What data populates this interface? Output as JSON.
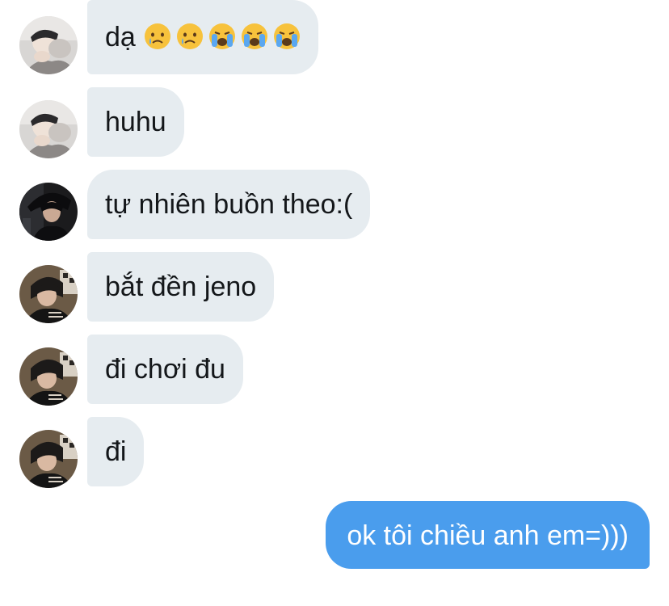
{
  "conversation": {
    "messages": [
      {
        "sender": "user-a",
        "text": "dạ",
        "emojis": [
          "crying-face-icon",
          "crying-face-icon",
          "loudly-crying-face-icon",
          "loudly-crying-face-icon",
          "loudly-crying-face-icon"
        ]
      },
      {
        "sender": "user-a",
        "text": "huhu"
      },
      {
        "sender": "user-b",
        "text": "tự nhiên buồn theo:("
      },
      {
        "sender": "user-c",
        "text": "bắt đền jeno"
      },
      {
        "sender": "user-c",
        "text": "đi chơi đu"
      },
      {
        "sender": "user-c",
        "text": "đi"
      },
      {
        "sender": "me",
        "text": "ok tôi chiều anh em=)))"
      }
    ]
  },
  "colors": {
    "incoming_bubble": "#e6ecf0",
    "outgoing_bubble": "#4a9ded",
    "text_dark": "#14171a",
    "text_light": "#ffffff"
  }
}
